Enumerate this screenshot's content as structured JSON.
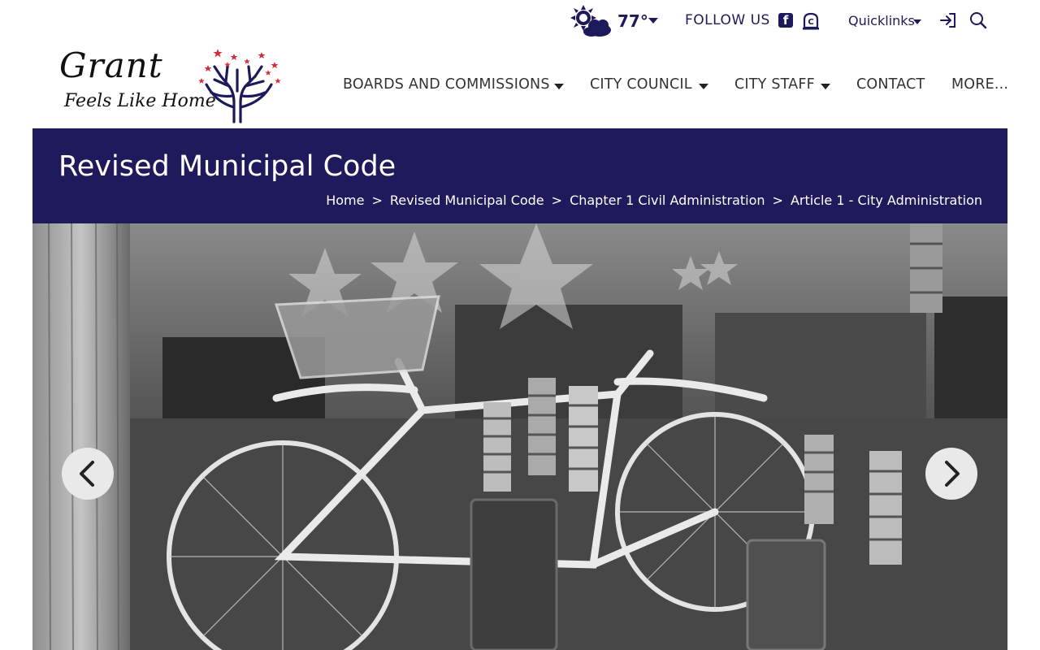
{
  "header": {
    "weather": {
      "icon": "partly-cloudy-icon",
      "temperature": "77°"
    },
    "follow_us": "FOLLOW US",
    "social": [
      {
        "icon": "facebook-icon",
        "glyph": "f"
      },
      {
        "icon": "civic-alert-icon"
      }
    ],
    "quicklinks": "Quicklinks",
    "login_icon": "sign-in-icon",
    "search_icon": "search-icon"
  },
  "logo": {
    "title": "Grant",
    "tagline": "Feels Like Home"
  },
  "nav": {
    "items": [
      {
        "label": "BOARDS AND COMMISSIONS",
        "has_dropdown": true
      },
      {
        "label": "CITY COUNCIL",
        "has_dropdown": true
      },
      {
        "label": "CITY STAFF",
        "has_dropdown": true
      },
      {
        "label": "CONTACT",
        "has_dropdown": false
      },
      {
        "label": "MORE...",
        "has_dropdown": false
      }
    ]
  },
  "banner": {
    "title": "Revised Municipal Code",
    "breadcrumb": [
      "Home",
      "Revised Municipal Code",
      "Chapter 1 Civil Administration",
      "Article 1 - City Administration"
    ],
    "separator": ">"
  },
  "hero": {
    "prev_icon": "chevron-left-icon",
    "next_icon": "chevron-right-icon"
  },
  "colors": {
    "brand_navy": "#1e1a5b",
    "text_navy": "#1c1a5a",
    "accent_red": "#d62b3a"
  }
}
